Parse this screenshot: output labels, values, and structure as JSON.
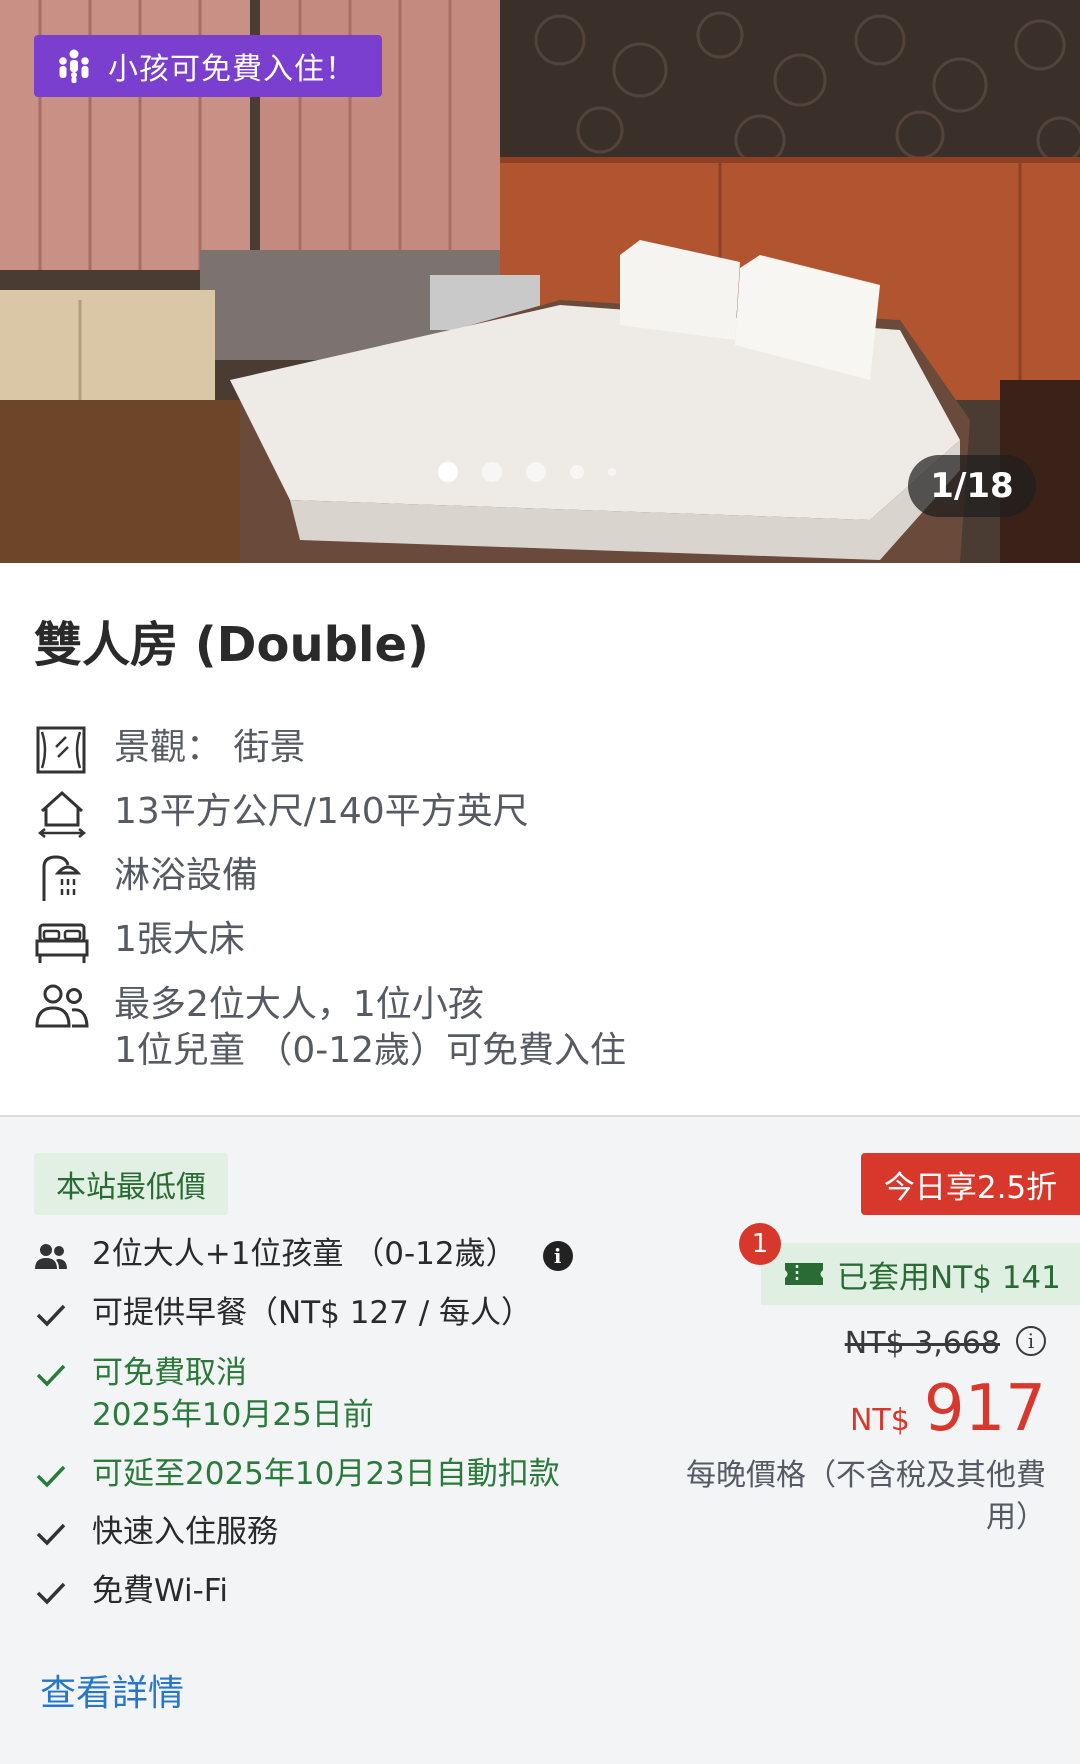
{
  "photo": {
    "kids_badge": "小孩可免費入住！",
    "counter": "1/18",
    "dots": 5,
    "active_dot": 0
  },
  "room": {
    "title": "雙人房 (Double)",
    "features": [
      {
        "icon": "window-view-icon",
        "text": "景觀： 街景"
      },
      {
        "icon": "room-size-icon",
        "text": "13平方公尺/140平方英尺"
      },
      {
        "icon": "shower-icon",
        "text": "淋浴設備"
      },
      {
        "icon": "bed-icon",
        "text": "1張大床"
      },
      {
        "icon": "people-icon",
        "line1": "最多2位大人，1位小孩",
        "line2": "1位兒童 （0-12歲）可免費入住"
      }
    ]
  },
  "offer": {
    "lowest_badge": "本站最低價",
    "occupancy": "2位大人+1位孩童 （0-12歲）",
    "breakfast": "可提供早餐（NT$ 127 / 每人）",
    "free_cancel_line1": "可免費取消",
    "free_cancel_line2": "2025年10月25日前",
    "pay_later": "可延至2025年10月23日自動扣款",
    "express_checkin": "快速入住服務",
    "wifi": "免費Wi-Fi",
    "discount_badge": "今日享2.5折",
    "coupon_count": "1",
    "coupon_applied": "已套用NT$ 141",
    "original_price": "NT$ 3,668",
    "currency": "NT$",
    "price": "917",
    "price_note": "每晚價格（不含稅及其他費用）",
    "details_link": "查看詳情"
  },
  "colors": {
    "purple": "#7b3fd0",
    "red": "#d8382b",
    "green": "#2a7a3b",
    "link": "#2477c9"
  }
}
